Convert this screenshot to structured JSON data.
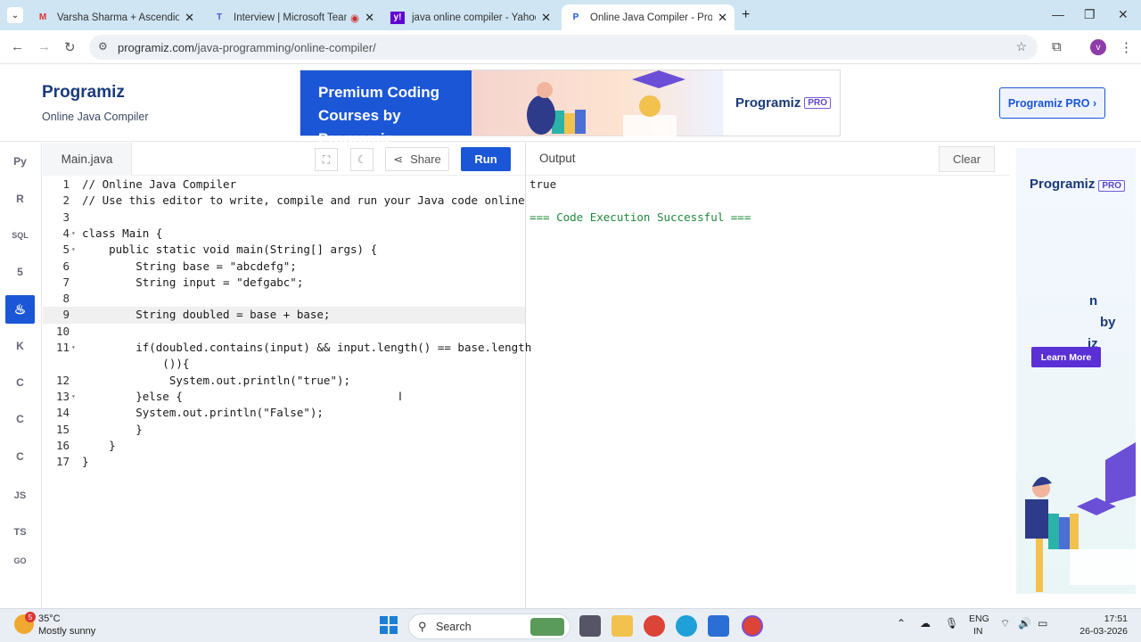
{
  "browser": {
    "tabs": [
      {
        "title": "Varsha Sharma + Ascendion - V",
        "icon": "gmail-icon"
      },
      {
        "title": "Interview | Microsoft Teams",
        "icon": "teams-icon"
      },
      {
        "title": "java online compiler - Yahoo In",
        "icon": "yahoo-icon"
      },
      {
        "title": "Online Java Compiler - Program",
        "icon": "programiz-icon",
        "active": true
      }
    ],
    "url_domain": "programiz.com",
    "url_path": "/java-programming/online-compiler/"
  },
  "header": {
    "logo": "Programiz",
    "subtitle": "Online Java Compiler",
    "banner_text": "Premium Coding Courses by Programiz",
    "banner_brand": "Programiz",
    "banner_pro": "PRO",
    "pro_button": "Programiz PRO ›"
  },
  "sidebar": {
    "items": [
      {
        "label": "Py",
        "icon": "python-icon"
      },
      {
        "label": "R",
        "icon": "r-icon"
      },
      {
        "label": "SQL",
        "icon": "database-icon"
      },
      {
        "label": "5",
        "icon": "html5-icon"
      },
      {
        "label": "♨",
        "icon": "java-icon",
        "active": true
      },
      {
        "label": "K",
        "icon": "kotlin-icon"
      },
      {
        "label": "C",
        "icon": "c-icon"
      },
      {
        "label": "C",
        "icon": "cpp-icon"
      },
      {
        "label": "C",
        "icon": "csharp-icon"
      },
      {
        "label": "JS",
        "icon": "javascript-icon"
      },
      {
        "label": "TS",
        "icon": "typescript-icon"
      },
      {
        "label": "GO",
        "icon": "go-icon"
      }
    ]
  },
  "editor": {
    "filename": "Main.java",
    "share_label": "Share",
    "run_label": "Run",
    "lines": [
      {
        "n": "1",
        "text": "// Online Java Compiler",
        "fold": ""
      },
      {
        "n": "2",
        "text": "// Use this editor to write, compile and run your Java code online",
        "fold": ""
      },
      {
        "n": "3",
        "text": "",
        "fold": ""
      },
      {
        "n": "4",
        "text": "class Main {",
        "fold": "▾"
      },
      {
        "n": "5",
        "text": "    public static void main(String[] args) {",
        "fold": "▾"
      },
      {
        "n": "6",
        "text": "        String base = \"abcdefg\";",
        "fold": ""
      },
      {
        "n": "7",
        "text": "        String input = \"defgabc\";",
        "fold": ""
      },
      {
        "n": "8",
        "text": "",
        "fold": ""
      },
      {
        "n": "9",
        "text": "        String doubled = base + base;",
        "fold": "",
        "highlight": true
      },
      {
        "n": "10",
        "text": "",
        "fold": ""
      },
      {
        "n": "11",
        "text": "        if(doubled.contains(input) && input.length() == base.length",
        "fold": "▾"
      },
      {
        "n": "",
        "text": "            ()){",
        "fold": ""
      },
      {
        "n": "12",
        "text": "             System.out.println(\"true\");",
        "fold": ""
      },
      {
        "n": "13",
        "text": "        }else {",
        "fold": "▾"
      },
      {
        "n": "14",
        "text": "        System.out.println(\"False\");",
        "fold": ""
      },
      {
        "n": "15",
        "text": "        }",
        "fold": ""
      },
      {
        "n": "16",
        "text": "    }",
        "fold": ""
      },
      {
        "n": "17",
        "text": "}",
        "fold": ""
      }
    ]
  },
  "output": {
    "label": "Output",
    "clear_label": "Clear",
    "lines": [
      "true",
      "",
      "=== Code Execution Successful ==="
    ]
  },
  "ad": {
    "brand": "Programiz",
    "pro": "PRO",
    "text_line1": "n",
    "text_line2": "by",
    "text_line3": "iz",
    "learn_more": "Learn More"
  },
  "taskbar": {
    "weather_badge": "5",
    "temperature": "35°C",
    "weather": "Mostly sunny",
    "search_placeholder": "Search",
    "lang1": "ENG",
    "lang2": "IN",
    "time": "17:51",
    "date": "26-03-2026"
  }
}
